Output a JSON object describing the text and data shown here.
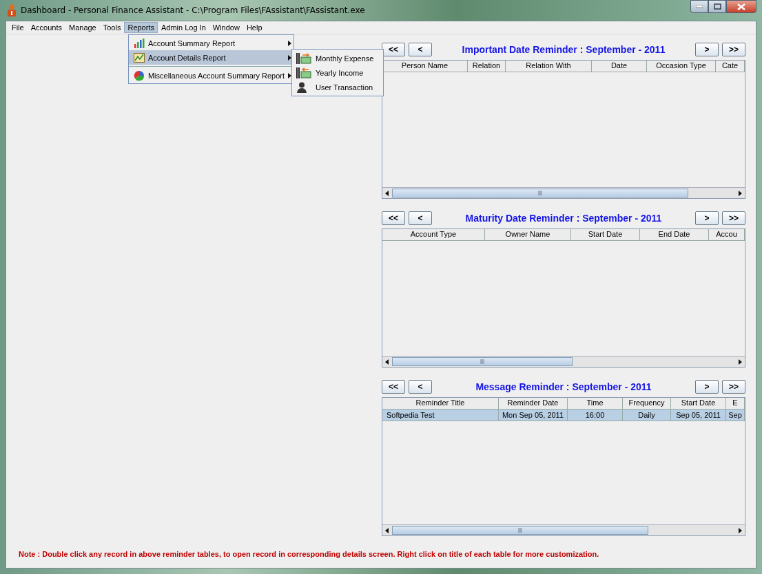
{
  "window": {
    "title": "Dashboard - Personal Finance Assistant - C:\\Program Files\\FAssistant\\FAssistant.exe"
  },
  "menu_bar": [
    {
      "label": "File",
      "selected": false
    },
    {
      "label": "Accounts",
      "selected": false
    },
    {
      "label": "Manage",
      "selected": false
    },
    {
      "label": "Tools",
      "selected": false
    },
    {
      "label": "Reports",
      "selected": true
    },
    {
      "label": "Admin Log In",
      "selected": false
    },
    {
      "label": "Window",
      "selected": false
    },
    {
      "label": "Help",
      "selected": false
    }
  ],
  "reports_menu": [
    {
      "kind": "item",
      "label": "Account Summary Report",
      "selected": false
    },
    {
      "kind": "item",
      "label": "Account Details Report",
      "selected": true
    },
    {
      "kind": "separator"
    },
    {
      "kind": "item",
      "label": "Miscellaneous Account Summary Report",
      "selected": false
    }
  ],
  "submenu": [
    {
      "label": "Monthly Expense"
    },
    {
      "label": "Yearly Income"
    },
    {
      "label": "User Transaction"
    }
  ],
  "panels": [
    {
      "nav": [
        "<<",
        "<",
        ">",
        ">>"
      ],
      "title": "Important Date Reminder : September - 2011",
      "columns": [
        "Person Name",
        "Relation",
        "Relation With",
        "Date",
        "Occasion Type",
        "Cate"
      ]
    },
    {
      "nav": [
        "<<",
        "<",
        ">",
        ">>"
      ],
      "title": "Maturity Date Reminder : September - 2011",
      "columns": [
        "Account Type",
        "Owner Name",
        "Start Date",
        "End Date",
        "Accou"
      ]
    },
    {
      "nav": [
        "<<",
        "<",
        ">",
        ">>"
      ],
      "title": "Message Reminder : September - 2011",
      "columns": [
        "Reminder Title",
        "Reminder Date",
        "Time",
        "Frequency",
        "Start Date",
        "E"
      ],
      "rows": [
        {
          "selected": true,
          "cells": [
            "Softpedia Test",
            "Mon Sep 05, 2011",
            "16:00",
            "Daily",
            "Sep 05, 2011",
            "Sep"
          ]
        }
      ]
    }
  ],
  "note": "Note : Double click any record in above reminder tables, to open record in corresponding details screen. Right click on title of each table for more customization."
}
